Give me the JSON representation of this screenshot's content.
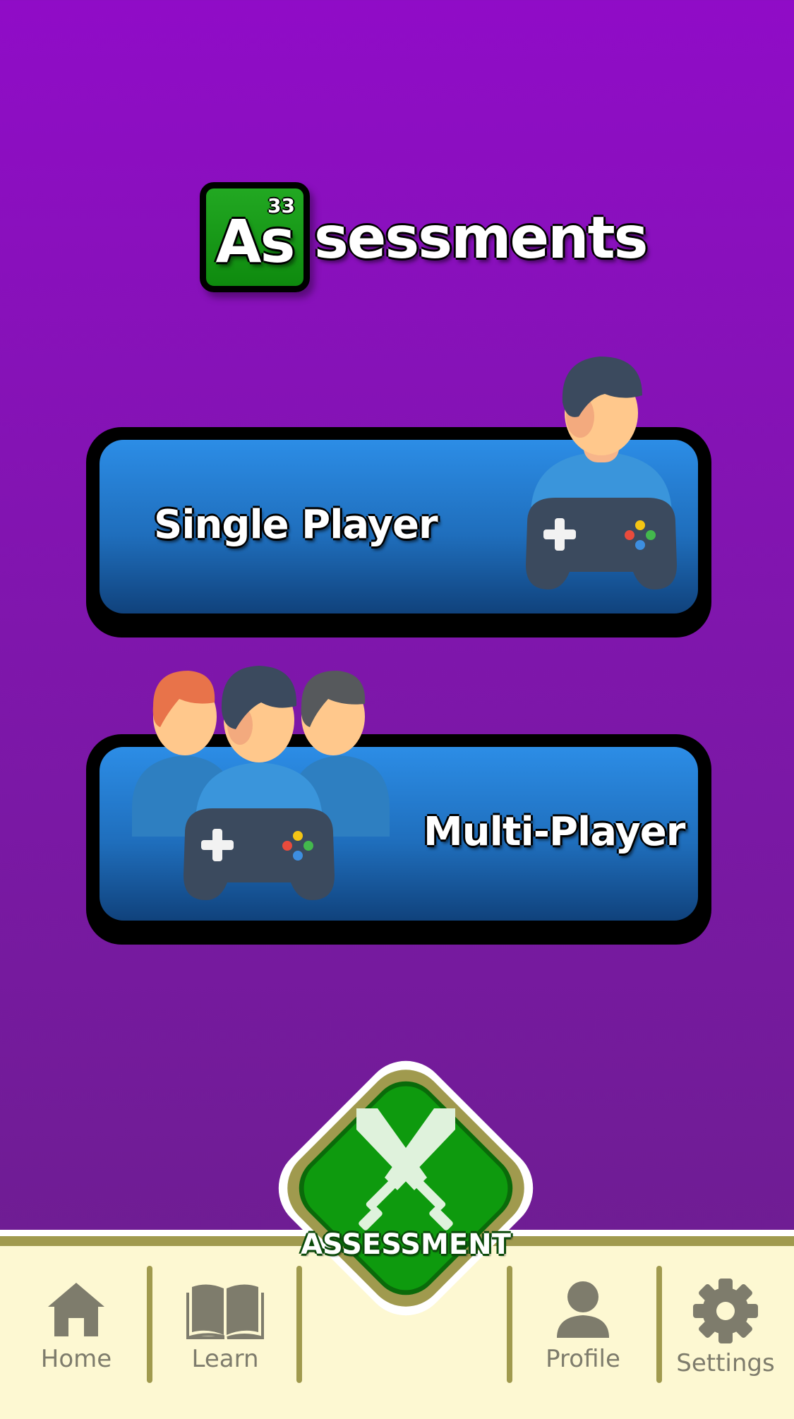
{
  "title": {
    "element_number": "33",
    "element_symbol": "As",
    "rest": "sessments"
  },
  "modes": {
    "single_label": "Single Player",
    "multi_label": "Multi-Player"
  },
  "center_button": {
    "label": "ASSESSMENT",
    "icon": "crossed-swords-icon"
  },
  "nav": {
    "items": [
      {
        "label": "Home",
        "icon": "home-icon"
      },
      {
        "label": "Learn",
        "icon": "book-icon"
      },
      {
        "label": "Profile",
        "icon": "person-icon"
      },
      {
        "label": "Settings",
        "icon": "gear-icon"
      }
    ]
  },
  "colors": {
    "background_top": "#900cc7",
    "background_bottom": "#6a1f8c",
    "mode_button": "#2c8de6",
    "assessment_green": "#0e9a0e",
    "nav_background": "#fdf8d2",
    "nav_accent": "#a09a4e",
    "nav_icon": "#7e7c6c"
  }
}
